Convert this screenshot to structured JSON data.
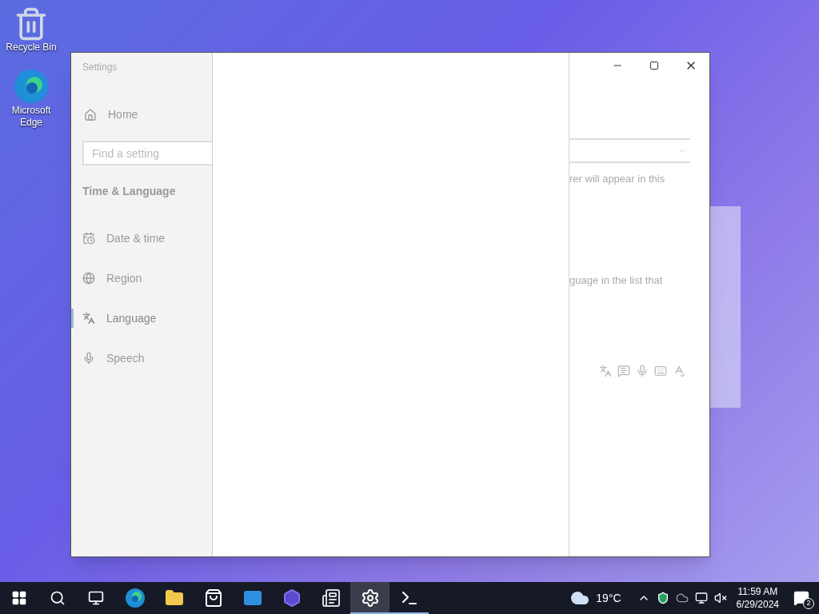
{
  "desktop_icons": [
    {
      "kind": "recycle",
      "label": "Recycle Bin"
    },
    {
      "kind": "edge",
      "label": "Microsoft Edge"
    }
  ],
  "window": {
    "title": "Settings",
    "home": "Home",
    "search": {
      "placeholder": "Find a setting"
    },
    "section": "Time & Language",
    "nav": [
      {
        "kind": "date",
        "label": "Date & time",
        "selected": false
      },
      {
        "kind": "region",
        "label": "Region",
        "selected": false
      },
      {
        "kind": "language",
        "label": "Language",
        "selected": true
      },
      {
        "kind": "speech",
        "label": "Speech",
        "selected": false
      }
    ],
    "content_texts": [
      "rer will appear in this",
      "guage in the list that"
    ]
  },
  "taskbar": {
    "apps": [
      {
        "kind": "edge",
        "selected": false,
        "running": false
      },
      {
        "kind": "explorer",
        "selected": false,
        "running": false
      },
      {
        "kind": "store",
        "selected": false,
        "running": false
      },
      {
        "kind": "mail",
        "selected": false,
        "running": false
      },
      {
        "kind": "copilot",
        "selected": false,
        "running": false
      },
      {
        "kind": "news",
        "selected": false,
        "running": false
      },
      {
        "kind": "settings",
        "selected": true,
        "running": true
      },
      {
        "kind": "terminal",
        "selected": false,
        "running": true
      }
    ],
    "weather": "19°C",
    "time": "11:59 AM",
    "date": "6/29/2024",
    "notifications": "2"
  }
}
